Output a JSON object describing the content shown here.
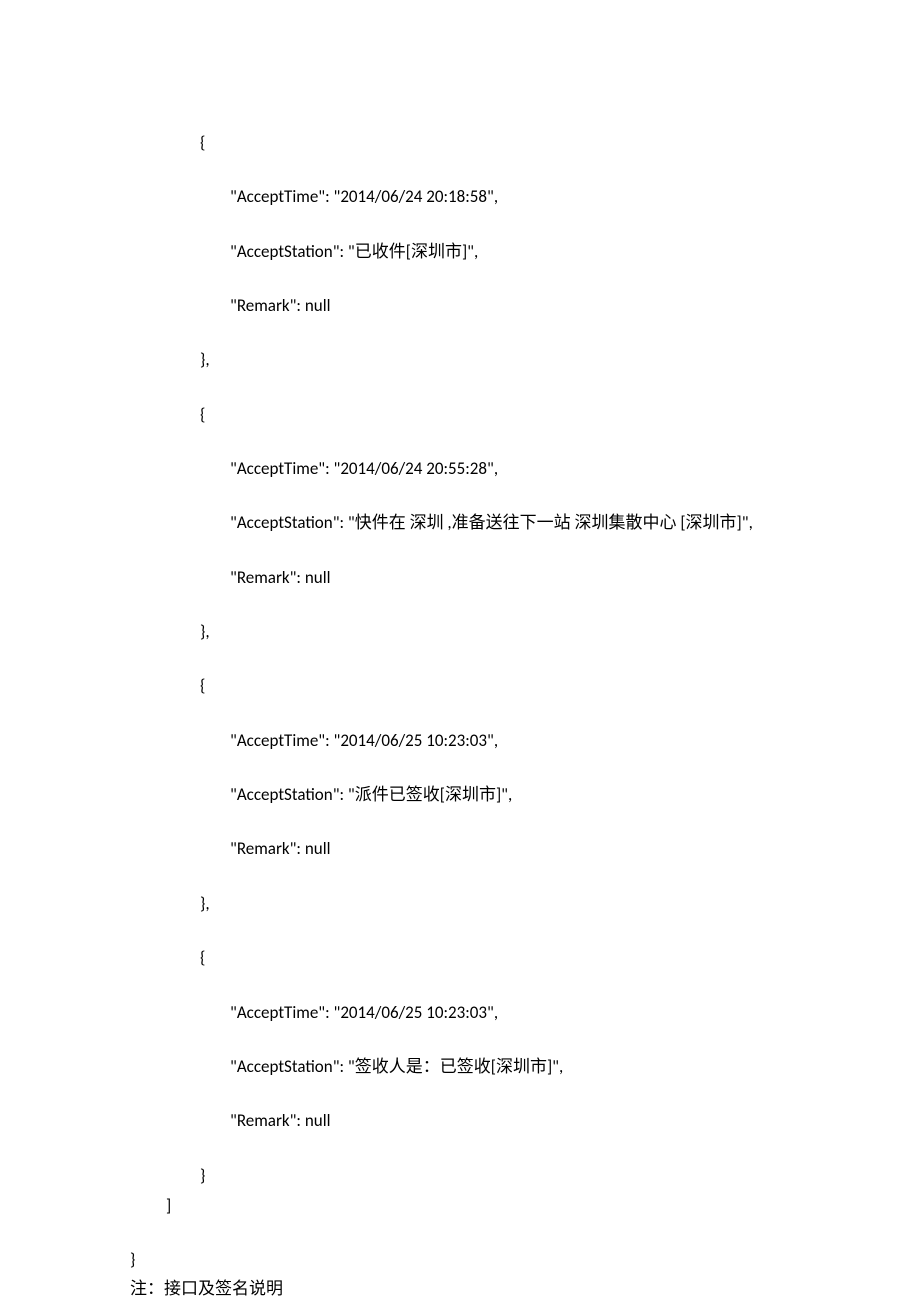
{
  "traces": [
    {
      "AcceptTime": "2014/06/24 20:18:58",
      "AcceptStation": "已收件[深圳市]",
      "Remark": "null"
    },
    {
      "AcceptTime": "2014/06/24 20:55:28",
      "AcceptStation": "快件在 深圳 ,准备送往下一站 深圳集散中心 [深圳市]",
      "Remark": "null"
    },
    {
      "AcceptTime": "2014/06/25 10:23:03",
      "AcceptStation": "派件已签收[深圳市]",
      "Remark": "null"
    },
    {
      "AcceptTime": "2014/06/25 10:23:03",
      "AcceptStation": "签收人是：已签收[深圳市]",
      "Remark": "null"
    }
  ],
  "keys": {
    "AcceptTime": "AcceptTime",
    "AcceptStation": "AcceptStation",
    "Remark": "Remark"
  },
  "syntax": {
    "openBrace": "{",
    "closeBrace": "}",
    "closeBraceComma": "},",
    "closeBracket": "]"
  },
  "note": "注：接口及签名说明"
}
